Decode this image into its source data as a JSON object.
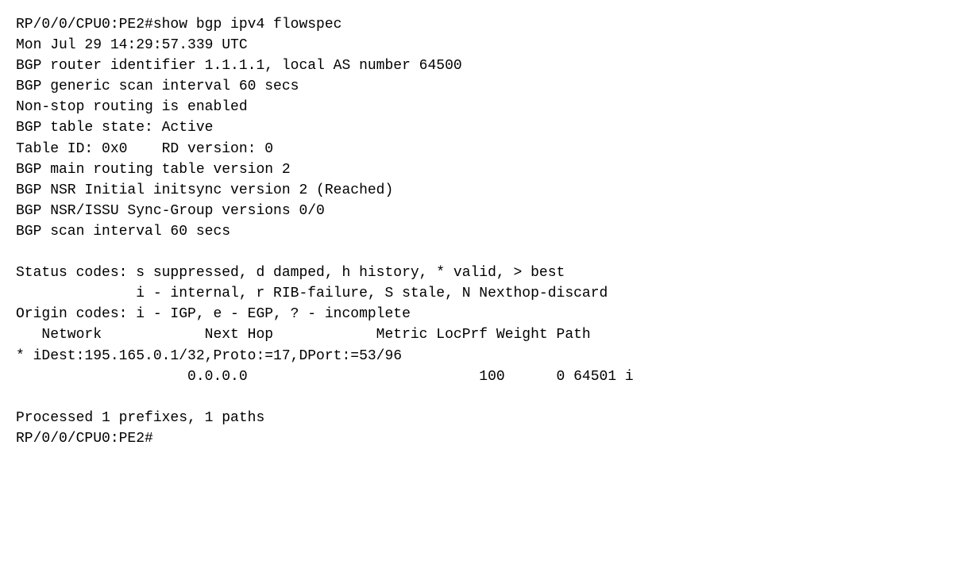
{
  "terminal": {
    "lines": [
      "RP/0/0/CPU0:PE2#show bgp ipv4 flowspec",
      "Mon Jul 29 14:29:57.339 UTC",
      "BGP router identifier 1.1.1.1, local AS number 64500",
      "BGP generic scan interval 60 secs",
      "Non-stop routing is enabled",
      "BGP table state: Active",
      "Table ID: 0x0    RD version: 0",
      "BGP main routing table version 2",
      "BGP NSR Initial initsync version 2 (Reached)",
      "BGP NSR/ISSU Sync-Group versions 0/0",
      "BGP scan interval 60 secs",
      "",
      "Status codes: s suppressed, d damped, h history, * valid, > best",
      "              i - internal, r RIB-failure, S stale, N Nexthop-discard",
      "Origin codes: i - IGP, e - EGP, ? - incomplete",
      "   Network            Next Hop            Metric LocPrf Weight Path",
      "* iDest:195.165.0.1/32,Proto:=17,DPort:=53/96",
      "                    0.0.0.0                           100      0 64501 i",
      "",
      "Processed 1 prefixes, 1 paths",
      "RP/0/0/CPU0:PE2#"
    ]
  }
}
